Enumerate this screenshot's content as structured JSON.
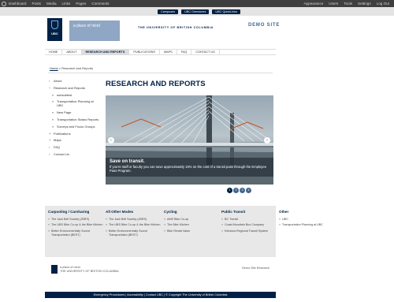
{
  "admin_bar": {
    "left_items": [
      "Dashboard",
      "Posts",
      "Media",
      "Links",
      "Pages",
      "Comments"
    ],
    "right_items": [
      "Appearance",
      "Users",
      "Tools",
      "Settings",
      "Log Out"
    ]
  },
  "clf_bar": {
    "buttons": [
      "Campuses",
      "UBC Directories",
      "UBC QuickLinks"
    ]
  },
  "header": {
    "crest_text": "UBC",
    "place_of_mind": "a place of mind",
    "university_name": "THE UNIVERSITY OF BRITISH COLUMBIA",
    "site_name": "DEMO SITE"
  },
  "nav": {
    "tabs": [
      "HOME",
      "ABOUT",
      "RESEARCH AND REPORTS",
      "PUBLICATIONS",
      "MAPS",
      "FAQ",
      "CONTACT US"
    ],
    "active_index": 2
  },
  "breadcrumb": {
    "home": "Home",
    "separator": " » ",
    "current": "Research and Reports"
  },
  "sidebar": {
    "items": [
      {
        "label": "About",
        "level": 1
      },
      {
        "label": "Research and Reports",
        "level": 1
      },
      {
        "label": "subsubtest",
        "level": 2
      },
      {
        "label": "Transportation Planning at UBC",
        "level": 2
      },
      {
        "label": "New Page",
        "level": 2
      },
      {
        "label": "Transportation Status Reports",
        "level": 2
      },
      {
        "label": "Surveys and Focus Groups",
        "level": 2
      },
      {
        "label": "Publications",
        "level": 1
      },
      {
        "label": "Maps",
        "level": 1
      },
      {
        "label": "FAQ",
        "level": 1
      },
      {
        "label": "Contact Us",
        "level": 1
      }
    ]
  },
  "content": {
    "title": "RESEARCH AND REPORTS",
    "slide": {
      "caption_title": "Save on transit.",
      "caption_body": "If you're staff or faculty you can save approximately 15% on the cost of a transit pass through the Employee Pass Program.",
      "prev_glyph": "‹",
      "next_glyph": "›",
      "pages": [
        "1",
        "2",
        "3",
        "4"
      ],
      "current_page": 1
    }
  },
  "footer_links": {
    "columns": [
      {
        "heading": "Carpooling / Carsharing",
        "items": [
          "The Jack Bell Society (JBRS)",
          "The UBS Bike Co-op & the Bike Kitchen",
          "Better Environmentally Sound Transportation (BEST)"
        ]
      },
      {
        "heading": "All Other Modes",
        "items": [
          "The Jack Bell Society (JBRS)",
          "The UBS Bike Co-op & the Bike Kitchen",
          "Better Environmentally Sound Transportation (BEST)"
        ]
      },
      {
        "heading": "Cycling",
        "items": [
          "AMS Bike Co-op",
          "The Bike Kitchen",
          "Bike Rental Value"
        ]
      },
      {
        "heading": "Public Transit",
        "items": [
          "BC Transit",
          "Coast Mountain Bus Company",
          "Kelowna Regional Transit System"
        ]
      },
      {
        "heading": "Other",
        "items": [
          "UBC",
          "Transportation Planning at UBC"
        ]
      }
    ]
  },
  "footer_brand": {
    "place_of_mind": "a place of mind",
    "university_name": "THE UNIVERSITY OF BRITISH COLUMBIA",
    "right_text": "Demo Site Research"
  },
  "footer_bar": {
    "text": "Emergency Procedures | Accessibility | Contact UBC | © Copyright The University of British Columbia"
  }
}
